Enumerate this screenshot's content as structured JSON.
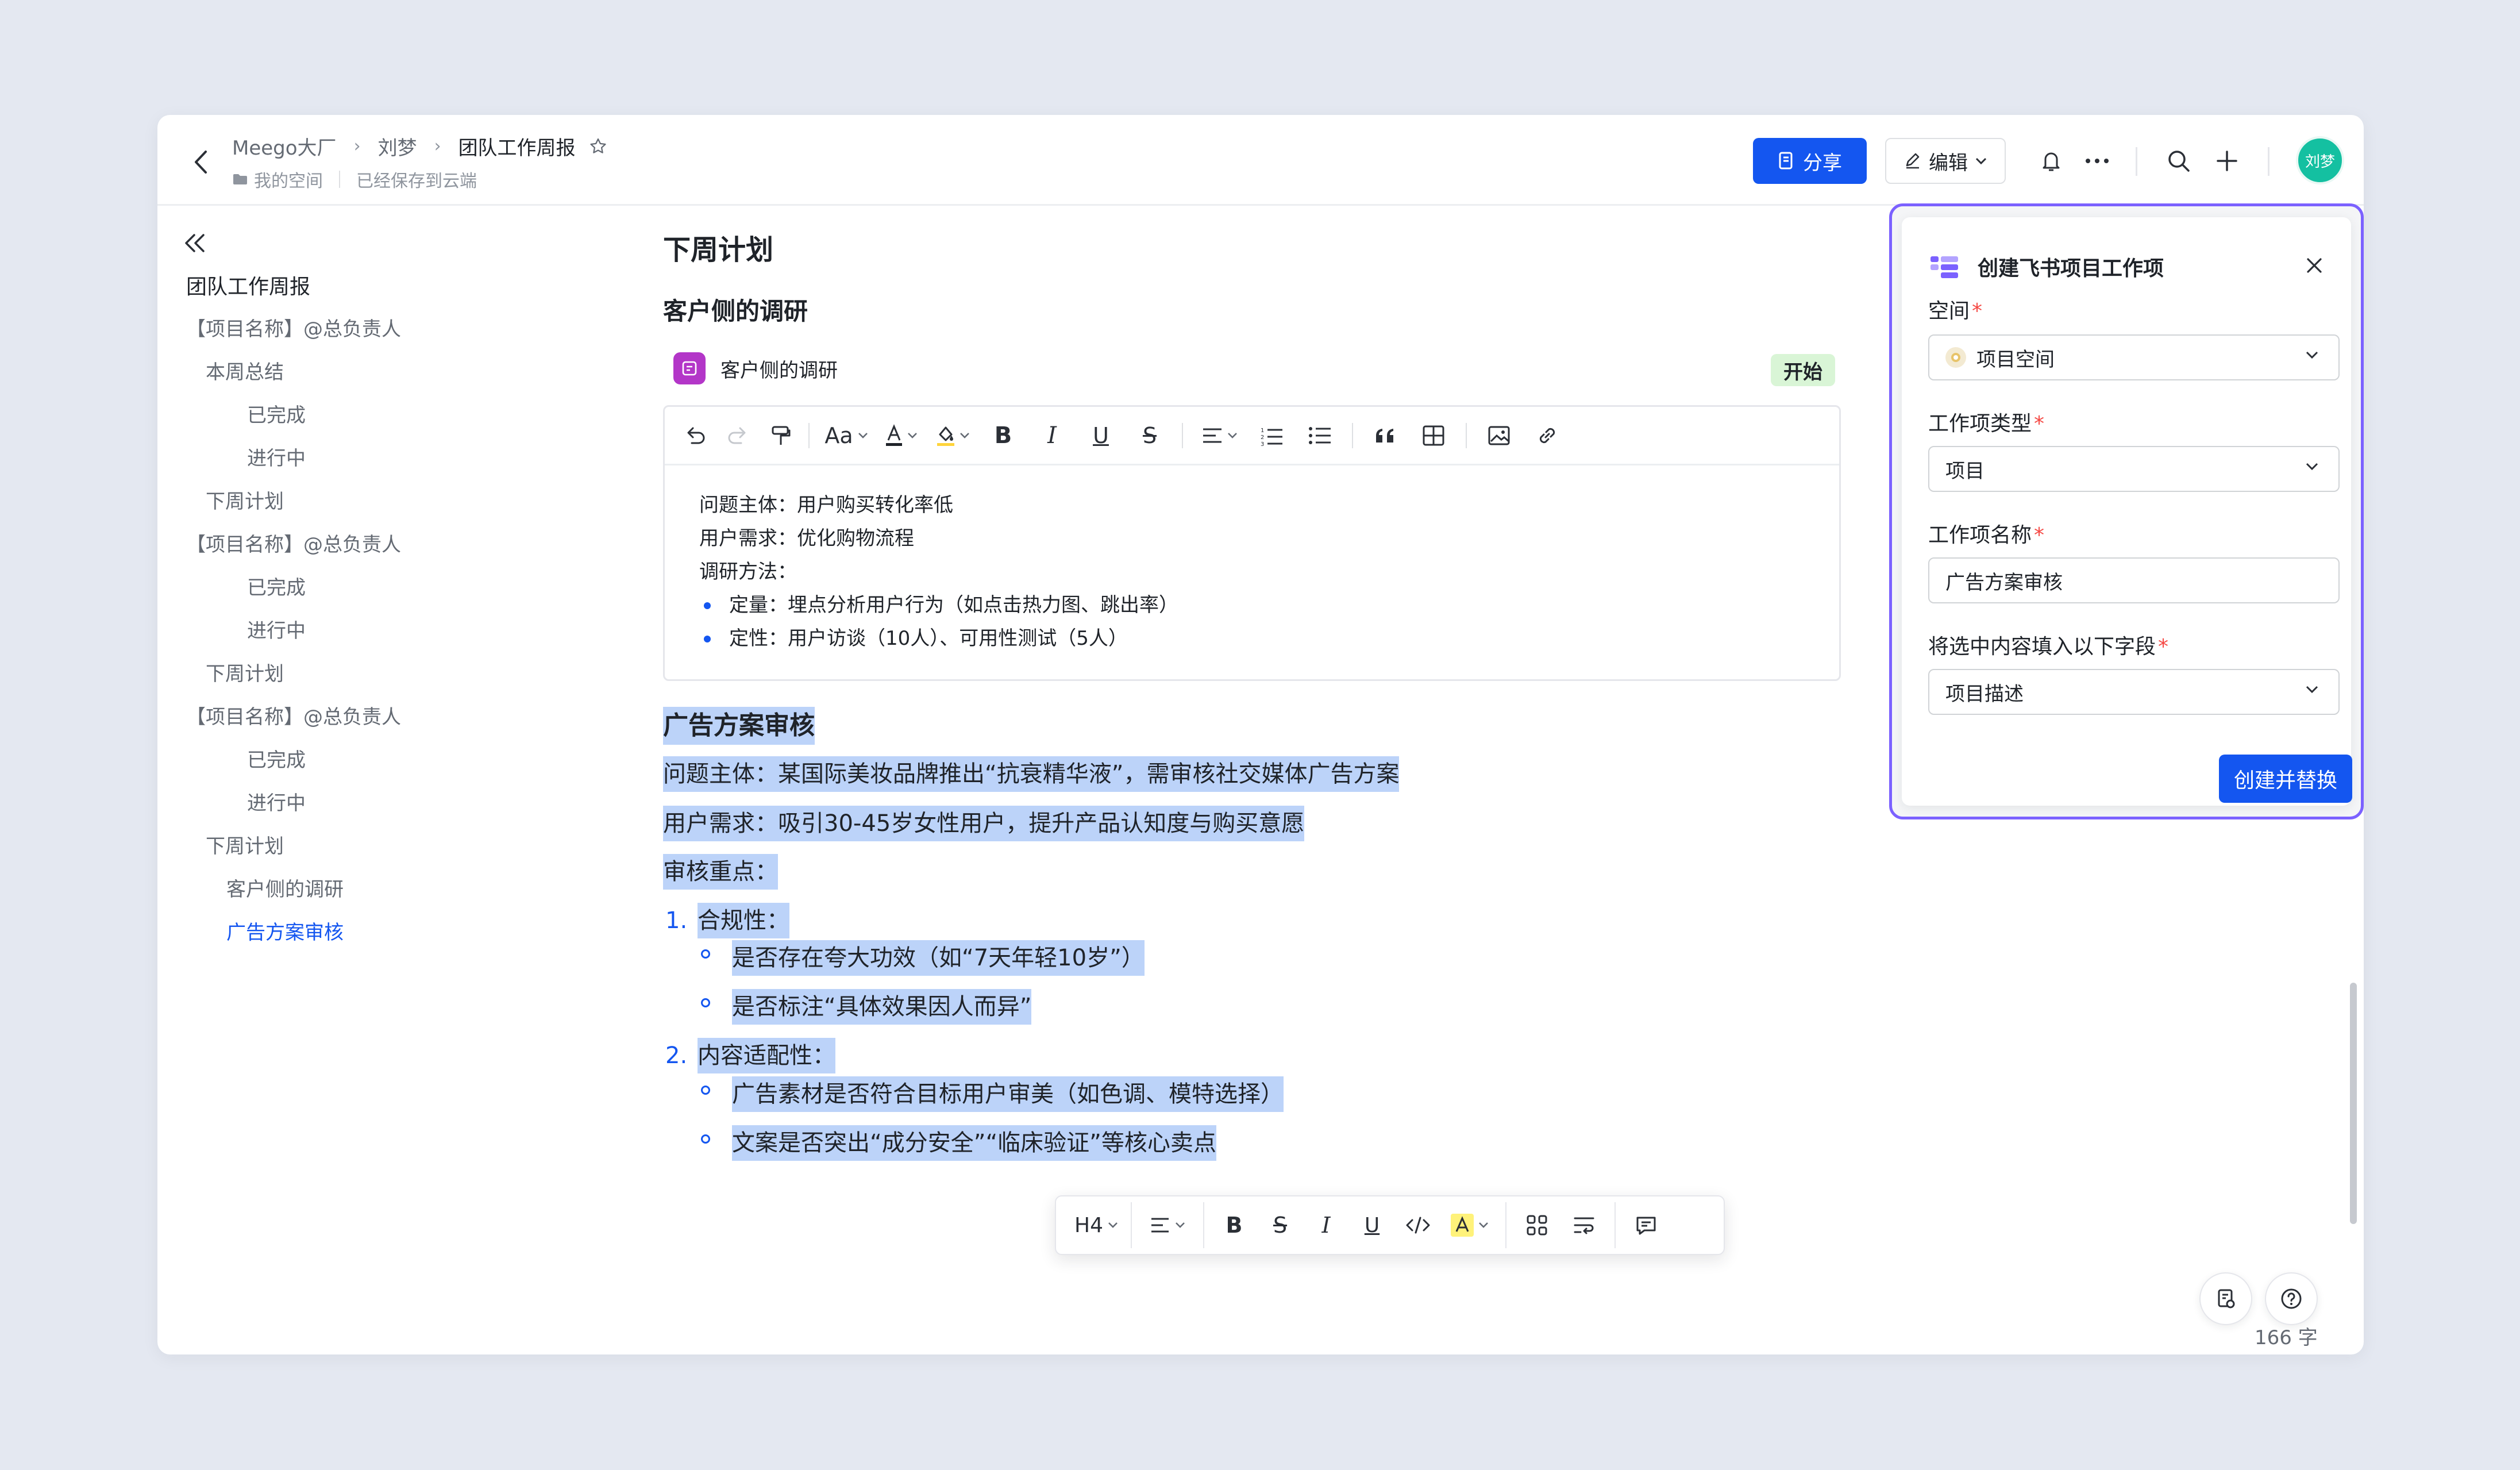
{
  "header": {
    "breadcrumbs": [
      "Meego大厂",
      "刘梦",
      "团队工作周报"
    ],
    "space_label": "我的空间",
    "save_status": "已经保存到云端",
    "share_label": "分享",
    "edit_label": "编辑",
    "avatar_text": "刘梦"
  },
  "outline": {
    "root": "团队工作周报",
    "items": [
      "【项目名称】@总负责人",
      "本周总结",
      "已完成",
      "进行中",
      "下周计划",
      "【项目名称】@总负责人",
      "已完成",
      "进行中",
      "下周计划",
      "【项目名称】@总负责人",
      "已完成",
      "进行中",
      "下周计划",
      "客户侧的调研",
      "广告方案审核"
    ]
  },
  "doc": {
    "heading_next_week": "下周计划",
    "heading_survey": "客户侧的调研",
    "work_item": {
      "title": "客户侧的调研",
      "status": "开始"
    },
    "editor_lines": [
      "问题主体：用户购买转化率低",
      "用户需求：优化购物流程",
      "调研方法："
    ],
    "editor_bullets": [
      "定量：埋点分析用户行为（如点击热力图、跳出率）",
      "定性：用户访谈（10人）、可用性测试（5人）"
    ],
    "editor_toolbar": {
      "font_size": "Aa"
    },
    "ad": {
      "title": "广告方案审核",
      "subject": "问题主体：某国际美妆品牌推出“抗衰精华液”，需审核社交媒体广告方案",
      "need": "用户需求：吸引30-45岁女性用户，提升产品认知度与购买意愿",
      "focus": "审核重点：",
      "n1": "1.",
      "item1": "合规性：",
      "item1_bullets": [
        "是否存在夸大功效（如“7天年轻10岁”）",
        "是否标注“具体效果因人而异”"
      ],
      "n2": "2.",
      "item2": "内容适配性：",
      "item2_bullets": [
        "广告素材是否符合目标用户审美（如色调、模特选择）",
        "文案是否突出“成分安全”“临床验证”等核心卖点"
      ]
    }
  },
  "format_bar": {
    "heading": "H4"
  },
  "panel": {
    "title": "创建飞书项目工作项",
    "space_label": "空间",
    "space_value": "项目空间",
    "type_label": "工作项类型",
    "type_value": "项目",
    "name_label": "工作项名称",
    "name_value": "广告方案审核",
    "field_label": "将选中内容填入以下字段",
    "field_value": "项目描述",
    "required_mark": "*",
    "submit_label": "创建并替换"
  },
  "footer": {
    "word_count": "166 字"
  },
  "colors": {
    "accent": "#1456f0",
    "panel_border": "#7b61ff",
    "selection": "#bcd3f9",
    "avatar": "#14c0a1"
  }
}
